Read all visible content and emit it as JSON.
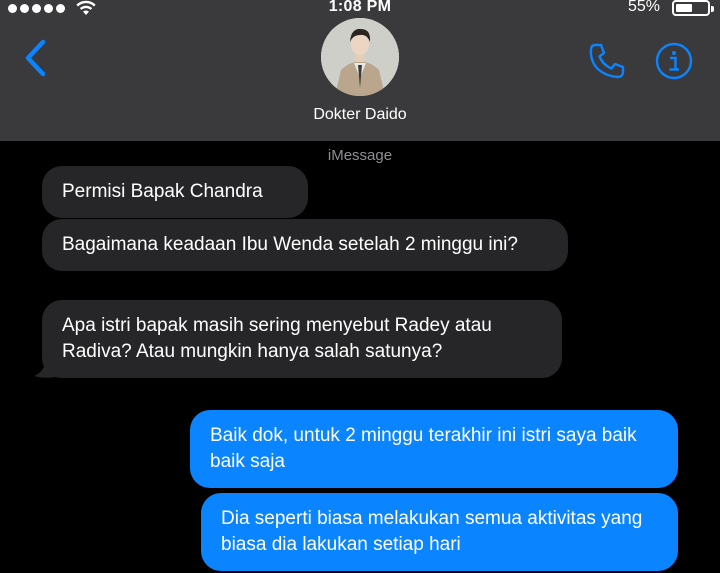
{
  "status_bar": {
    "time": "1:08 PM",
    "battery_percent": "55%"
  },
  "conversation": {
    "contact_name": "Dokter Daido",
    "service": "iMessage"
  },
  "icons": {
    "back": "chevron-left-icon",
    "call": "phone-icon",
    "info": "info-icon"
  },
  "colors": {
    "accent": "#0a84ff",
    "header_bg": "#3a3a3c",
    "incoming_bubble": "#262628",
    "outgoing_bubble": "#0a84ff"
  },
  "messages": [
    {
      "direction": "incoming",
      "text": "Permisi Bapak Chandra"
    },
    {
      "direction": "incoming",
      "text": "Bagaimana keadaan Ibu Wenda setelah 2 minggu ini?"
    },
    {
      "direction": "incoming",
      "text": "Apa istri bapak masih sering menyebut Radey atau Radiva? Atau mungkin hanya salah satunya?"
    },
    {
      "direction": "outgoing",
      "text": "Baik dok, untuk 2 minggu terakhir ini istri saya baik baik saja"
    },
    {
      "direction": "outgoing",
      "text": "Dia seperti biasa melakukan semua aktivitas yang biasa dia lakukan setiap hari"
    }
  ]
}
